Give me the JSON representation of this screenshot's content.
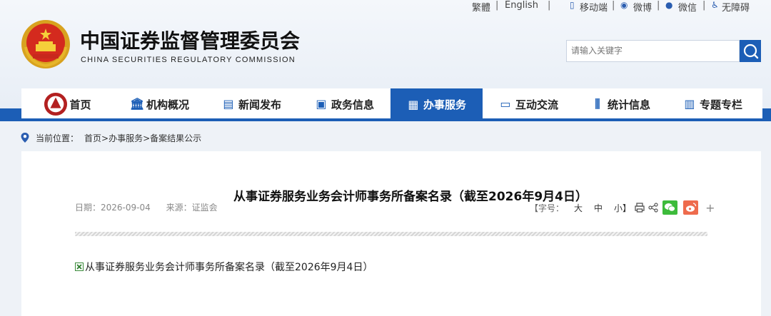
{
  "header": {
    "title_cn": "中国证券监督管理委员会",
    "title_en": "CHINA SECURITIES REGULATORY COMMISSION",
    "top_links": {
      "traditional": "繁體",
      "english": "English",
      "mobile": "移动端",
      "weibo": "微博",
      "wechat": "微信",
      "accessibility": "无障碍"
    },
    "search_placeholder": "请输入关键字"
  },
  "nav": {
    "items": [
      {
        "label": "首页",
        "icon": "emblem-icon"
      },
      {
        "label": "机构概况",
        "icon": "building-icon"
      },
      {
        "label": "新闻发布",
        "icon": "news-icon"
      },
      {
        "label": "政务信息",
        "icon": "monitor-icon"
      },
      {
        "label": "办事服务",
        "icon": "document-icon",
        "active": true
      },
      {
        "label": "互动交流",
        "icon": "chat-icon"
      },
      {
        "label": "统计信息",
        "icon": "bar-chart-icon"
      },
      {
        "label": "专题专栏",
        "icon": "list-icon"
      }
    ]
  },
  "breadcrumb": {
    "prefix": "当前位置：",
    "path": "首页>办事服务>备案结果公示"
  },
  "article": {
    "title": "从事证券服务业务会计师事务所备案名录（截至2026年9月4日）",
    "date_label": "日期：",
    "date": "2026-09-04",
    "source_label": "来源：",
    "source": "证监会",
    "font_size_label": "【字号：",
    "font_large": "大",
    "font_medium": "中",
    "font_small": "小】",
    "attachment": "从事证券服务业务会计师事务所备案名录（截至2026年9月4日）"
  },
  "colors": {
    "brand_blue": "#1c5eb6",
    "wechat_green": "#3dbb3b",
    "weibo_red": "#ee6b4d"
  }
}
